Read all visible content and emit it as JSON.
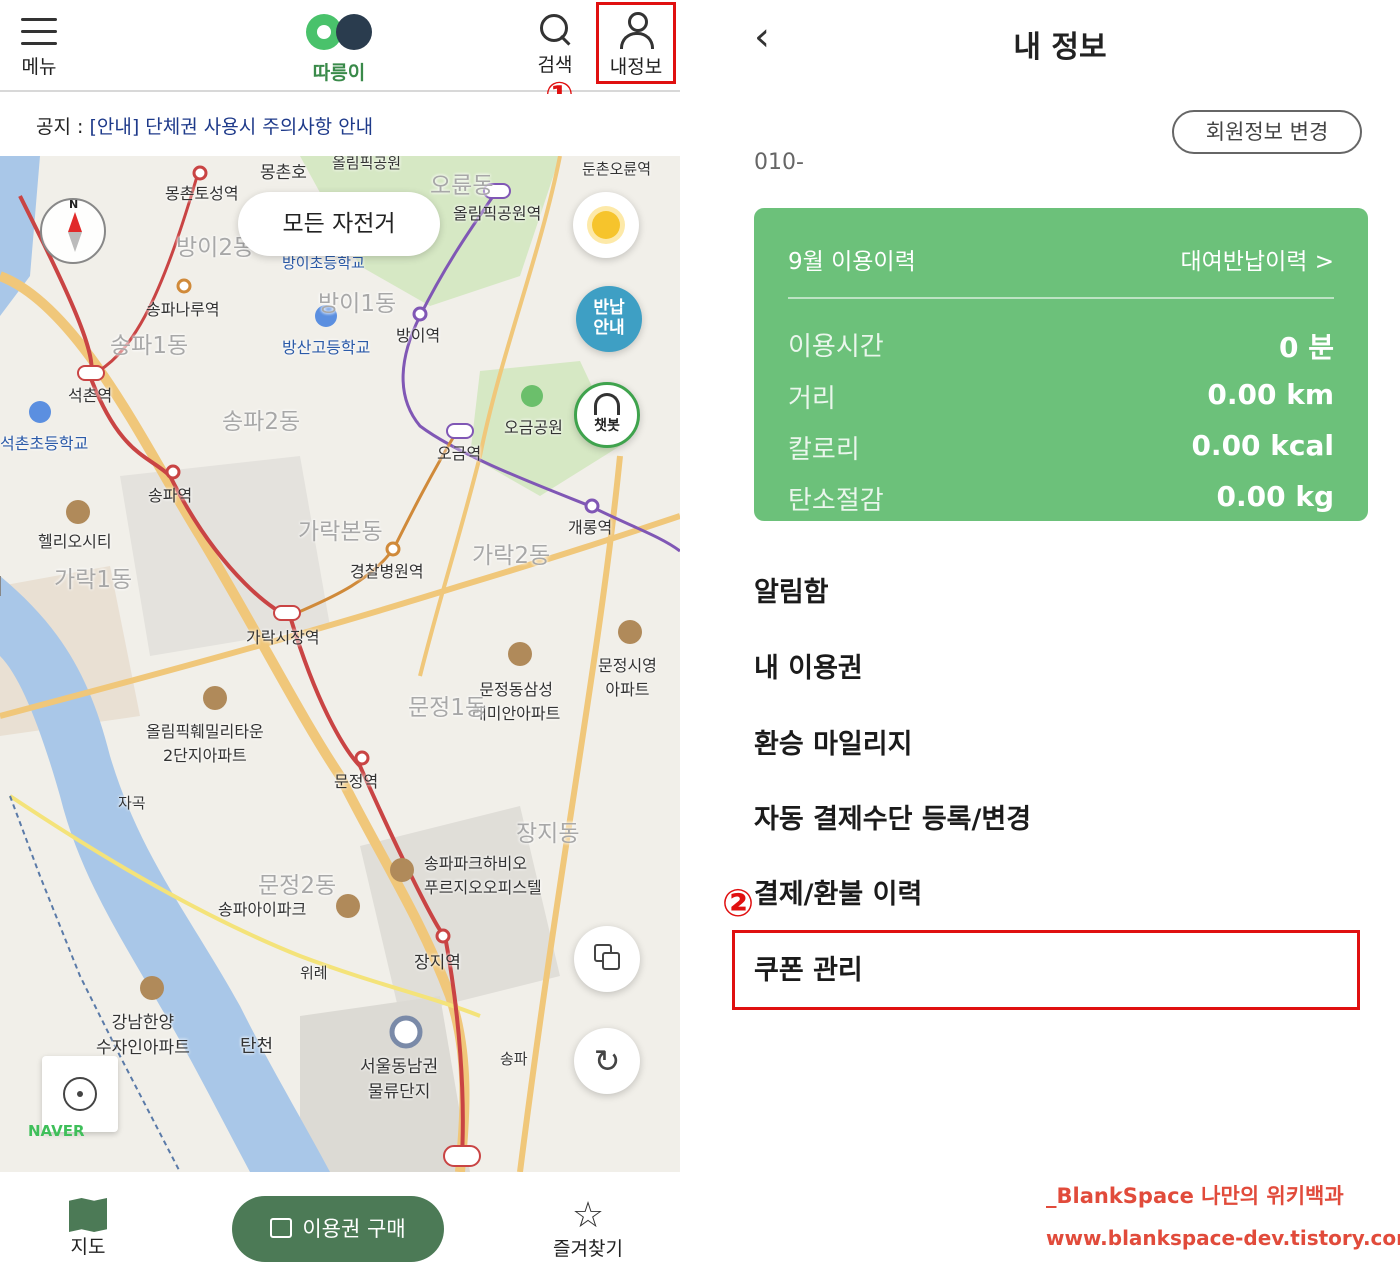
{
  "left": {
    "topbar": {
      "menu_label": "메뉴",
      "logo_label": "따릉이",
      "search_label": "검색",
      "myinfo_label": "내정보"
    },
    "marker_1": "①",
    "notice": {
      "prefix": "공지 : ",
      "text": "[안내] 단체권 사용시 주의사항 안내"
    },
    "map": {
      "filter_chip": "모든 자전거",
      "return_guide": "반납\n안내",
      "chatbot_label": "챗봇",
      "naver_logo": "NAVER",
      "compass_north": "N",
      "labels": [
        "몽촌호",
        "올림픽공원",
        "오륜동",
        "둔촌오륜역",
        "몽촌토성역",
        "올림픽공원역",
        "방이2동",
        "방이초등학교",
        "송파나루역",
        "방이1동",
        "방산고등학교",
        "방이역",
        "송파1동",
        "석촌역",
        "오금공원",
        "석촌초등학교",
        "송파2동",
        "오금역",
        "송파역",
        "개롱역",
        "헬리오시티",
        "가락본동",
        "가락2동",
        "경찰병원역",
        "가락1동",
        "가락시장역",
        "문정시영\n아파트",
        "문정동삼성\n래미안아파트",
        "문정1동",
        "올림픽훼밀리타운\n2단지아파트",
        "문정역",
        "자곡",
        "장지동",
        "송파파크하비오\n푸르지오오피스텔",
        "문정2동",
        "송파아이파크",
        "장지역",
        "위례",
        "강남한양\n수자인아파트",
        "탄천",
        "서울동남권\n물류단지",
        "송파"
      ]
    },
    "bottombar": {
      "map_label": "지도",
      "buy_label": "이용권 구매",
      "fav_label": "즐겨찾기"
    }
  },
  "right": {
    "title": "내 정보",
    "edit_button": "회원정보 변경",
    "phone": "010-",
    "card": {
      "month_label": "9월 이용이력",
      "history_link": "대여반납이력 >",
      "stats": [
        {
          "key": "이용시간",
          "value": "0 분"
        },
        {
          "key": "거리",
          "value": "0.00 km"
        },
        {
          "key": "칼로리",
          "value": "0.00 kcal"
        },
        {
          "key": "탄소절감",
          "value": "0.00 kg"
        }
      ]
    },
    "menu": [
      "알림함",
      "내 이용권",
      "환승 마일리지",
      "자동 결제수단 등록/변경",
      "결제/환불 이력",
      "쿠폰 관리"
    ],
    "marker_2": "②"
  },
  "watermark": {
    "line1": "_BlankSpace 나만의 위키백과",
    "line2": "www.blankspace-dev.tistory.com"
  },
  "colors": {
    "accent_green": "#4c7a56",
    "card_green": "#6cc17a",
    "annotation_red": "#e01010"
  }
}
